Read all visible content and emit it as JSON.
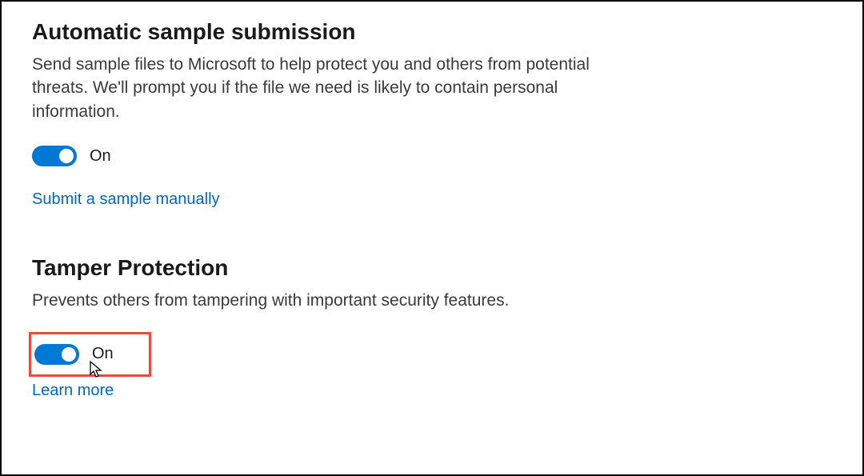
{
  "sections": {
    "sample_submission": {
      "title": "Automatic sample submission",
      "description": "Send sample files to Microsoft to help protect you and others from potential threats. We'll prompt you if the file we need is likely to contain personal information.",
      "toggle_state": "On",
      "link_text": "Submit a sample manually"
    },
    "tamper_protection": {
      "title": "Tamper Protection",
      "description": "Prevents others from tampering with important security features.",
      "toggle_state": "On",
      "link_text": "Learn more"
    }
  },
  "colors": {
    "accent": "#0078d4",
    "link": "#0066cc",
    "highlight_border": "#e74c3c"
  }
}
